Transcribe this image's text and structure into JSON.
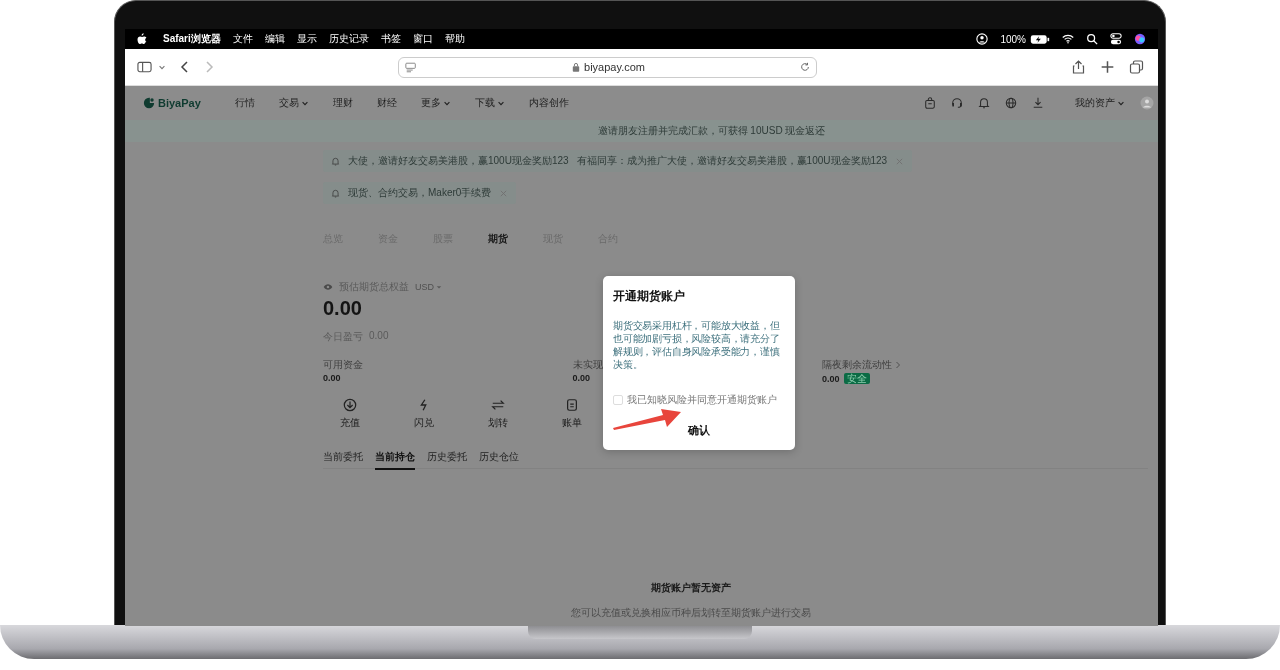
{
  "menu_bar": {
    "app": "Safari浏览器",
    "items": [
      "文件",
      "编辑",
      "显示",
      "历史记录",
      "书签",
      "窗口",
      "帮助"
    ],
    "battery": "100%"
  },
  "browser": {
    "url": "biyapay.com"
  },
  "site_nav": {
    "logo": "BiyaPay",
    "items": [
      {
        "label": "行情",
        "dropdown": false
      },
      {
        "label": "交易",
        "dropdown": true
      },
      {
        "label": "理财",
        "dropdown": false
      },
      {
        "label": "财经",
        "dropdown": false
      },
      {
        "label": "更多",
        "dropdown": true
      },
      {
        "label": "下载",
        "dropdown": true
      },
      {
        "label": "内容创作",
        "dropdown": false
      }
    ],
    "account": {
      "label": "我的资产",
      "dropdown": true
    }
  },
  "banner": "邀请朋友注册并完成汇款，可获得 10USD 现金返还",
  "notices": [
    {
      "messages": [
        "大使，邀请好友交易美港股，赢100U现金奖励123",
        "有福同享：成为推广大使，邀请好友交易美港股，赢100U现金奖励123"
      ]
    },
    {
      "messages": [
        "现货、合约交易，Maker0手续费"
      ]
    }
  ],
  "account_tabs": [
    {
      "label": "总览",
      "selected": false
    },
    {
      "label": "资金",
      "selected": false
    },
    {
      "label": "股票",
      "selected": false
    },
    {
      "label": "期货",
      "selected": true
    },
    {
      "label": "现货",
      "selected": false
    },
    {
      "label": "合约",
      "selected": false
    }
  ],
  "equity": {
    "label": "预估期货总权益",
    "currency": "USD",
    "value": "0.00",
    "pnl_label": "今日盈亏",
    "pnl": "0.00"
  },
  "stats": [
    {
      "label": "可用资金",
      "value": "0.00"
    },
    {
      "label": "未实现",
      "value": "0.00"
    },
    {
      "label": "隔夜剩余流动性",
      "value": "0.00",
      "link": true,
      "badge": "安全"
    }
  ],
  "actions": [
    {
      "kind": "deposit",
      "label": "充值"
    },
    {
      "kind": "flash",
      "label": "闪兑"
    },
    {
      "kind": "transfer",
      "label": "划转"
    },
    {
      "kind": "bill",
      "label": "账单"
    }
  ],
  "position_tabs": [
    {
      "label": "当前委托",
      "selected": false
    },
    {
      "label": "当前持仓",
      "selected": true
    },
    {
      "label": "历史委托",
      "selected": false
    },
    {
      "label": "历史仓位",
      "selected": false
    }
  ],
  "empty": {
    "title": "期货账户暂无资产",
    "hint": "您可以充值或兑换相应币种后划转至期货账户进行交易"
  },
  "modal": {
    "title": "开通期货账户",
    "body": "期货交易采用杠杆，可能放大收益，但也可能加剧亏损，风险较高，请充分了解规则，评估自身风险承受能力，谨慎决策。",
    "checkbox": {
      "label": "我已知晓风险并同意开通期货账户",
      "checked": false
    },
    "button": "确认"
  }
}
